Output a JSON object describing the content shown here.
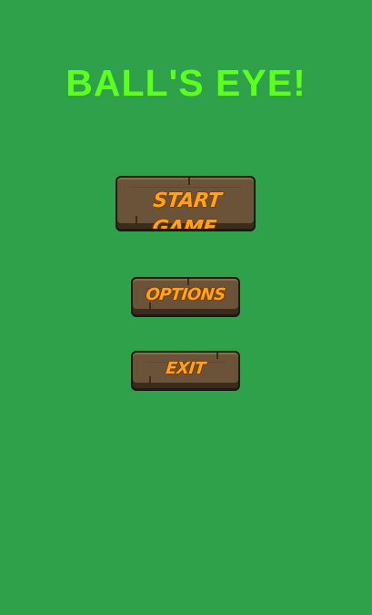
{
  "game": {
    "title": "BALL'S EYE!"
  },
  "menu": {
    "start_label": "START GAME",
    "options_label": "OPTIONS",
    "exit_label": "EXIT"
  },
  "colors": {
    "background": "#2ea14a",
    "title": "#5dff1f",
    "button_wood": "#6a5338",
    "button_text": "#ffa41a"
  }
}
